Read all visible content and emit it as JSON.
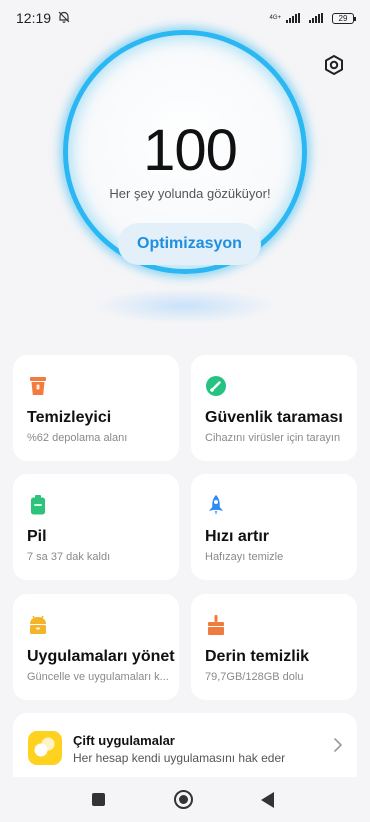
{
  "status_bar": {
    "time": "12:19",
    "network": "4G+",
    "battery": "29"
  },
  "score": {
    "value": "100",
    "subtitle": "Her şey yolunda gözüküyor!",
    "button_label": "Optimizasyon"
  },
  "cards": [
    {
      "title": "Temizleyici",
      "desc": "%62 depolama alanı",
      "icon": "trash-icon",
      "color": "#f27b3d"
    },
    {
      "title": "Güvenlik taraması",
      "desc": "Cihazını virüsler için tarayın",
      "icon": "security-scan-icon",
      "color": "#26c281"
    },
    {
      "title": "Pil",
      "desc": "7 sa 37 dak  kaldı",
      "icon": "battery-icon",
      "color": "#2bc47a"
    },
    {
      "title": "Hızı artır",
      "desc": "Hafızayı temizle",
      "icon": "rocket-icon",
      "color": "#2d8df3"
    },
    {
      "title": "Uygulamaları yönet",
      "desc": "Güncelle ve uygulamaları k...",
      "icon": "android-icon",
      "color": "#f3b42a"
    },
    {
      "title": "Derin temizlik",
      "desc": "79,7GB/128GB dolu",
      "icon": "broom-icon",
      "color": "#f07b3f"
    }
  ],
  "dual_apps": {
    "title": "Çift uygulamalar",
    "desc": "Her hesap kendi uygulamasını hak eder",
    "icon": "dual-apps-icon",
    "color": "#ffd21f"
  },
  "nav": {
    "recents": "recents-icon",
    "home": "home-icon",
    "back": "back-icon"
  }
}
